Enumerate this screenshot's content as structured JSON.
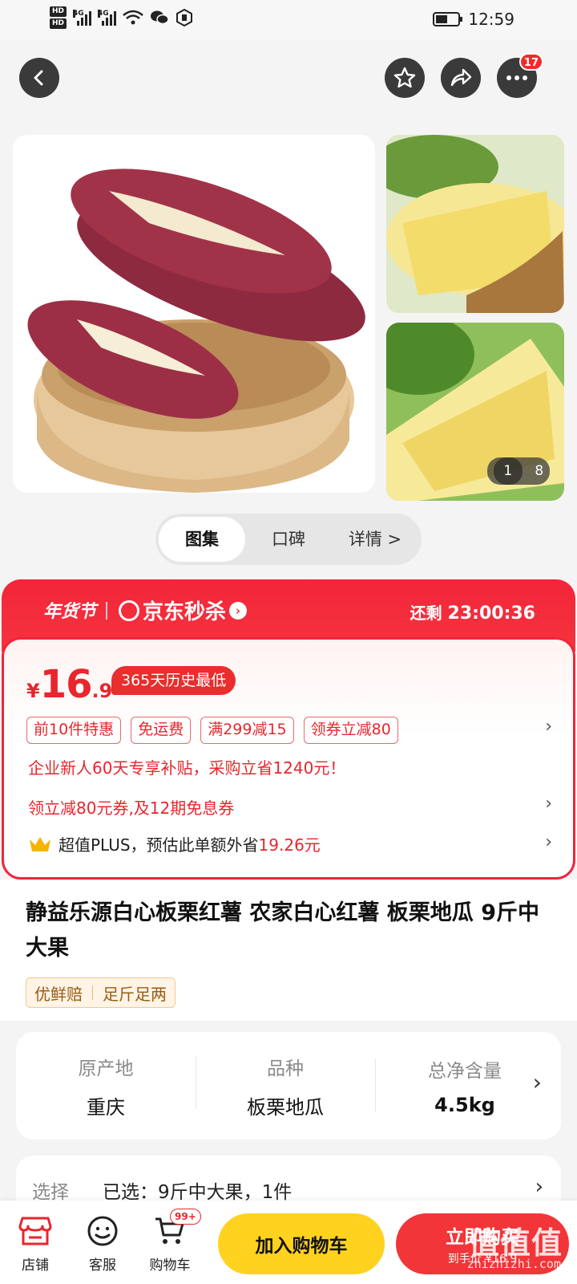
{
  "status_bar": {
    "hd1": "HD",
    "hd2": "HD",
    "net1": "4G",
    "net2": "4G",
    "time": "12:59"
  },
  "top_nav": {
    "more_badge": "17"
  },
  "gallery": {
    "counter_current": "1",
    "counter_total": "8",
    "tabs": [
      {
        "label": "图集"
      },
      {
        "label": "口碑"
      },
      {
        "label": "详情 >"
      }
    ]
  },
  "promo": {
    "festival": "年货节",
    "seckill": "京东秒杀",
    "remain_label": "还剩",
    "remain_time": "23:00:36",
    "currency": "¥",
    "price_int": "16",
    "price_dec": ".9",
    "low_tag": "365天历史最低",
    "chips": [
      {
        "label": "前10件特惠"
      },
      {
        "label": "免运费"
      },
      {
        "label": "满299减15"
      },
      {
        "label": "领券立减80"
      }
    ],
    "enterprise": "企业新人60天专享补贴，采购立省1240元！",
    "coupon": "领立减80元券,及12期免息券",
    "plus_prefix": "超值PLUS，预估此单额外省",
    "plus_amount": "19.26元"
  },
  "product": {
    "title": "静益乐源白心板栗红薯 农家白心红薯 板栗地瓜 9斤中大果",
    "tags": [
      "优鲜赔",
      "足斤足两"
    ]
  },
  "specs": [
    {
      "key": "原产地",
      "value": "重庆"
    },
    {
      "key": "品种",
      "value": "板栗地瓜"
    },
    {
      "key": "总净含量",
      "value": "4.5kg"
    }
  ],
  "select": {
    "label": "选择",
    "value": "已选：9斤中大果，1件"
  },
  "bottom_bar": {
    "shop": "店铺",
    "service": "客服",
    "cart": "购物车",
    "cart_badge": "99+",
    "add_cart": "加入购物车",
    "buy_now": "立即购买",
    "buy_price": "到手价 ¥16.9"
  },
  "watermark": {
    "text": "值值值",
    "sub": "zhizhizhi.com"
  },
  "colors": {
    "accent_red": "#f2263a",
    "yellow": "#ffd21f"
  }
}
